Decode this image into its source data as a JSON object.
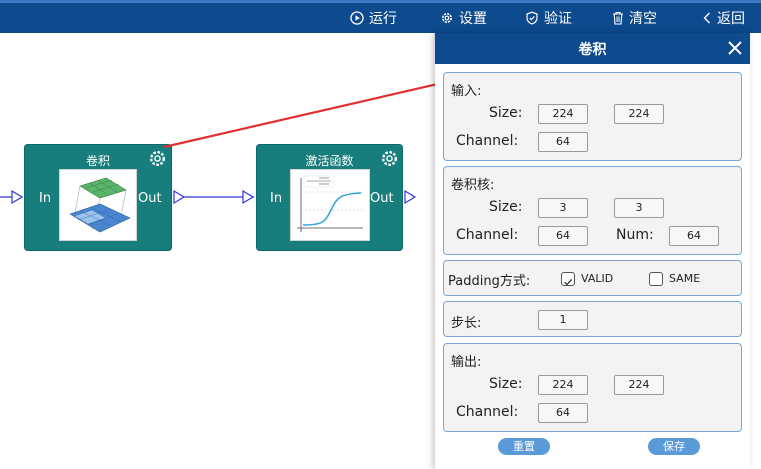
{
  "toolbar": {
    "run": "运行",
    "settings": "设置",
    "validate": "验证",
    "clear": "清空",
    "back": "返回"
  },
  "nodes": {
    "conv": {
      "title": "卷积",
      "in": "In",
      "out": "Out"
    },
    "activation": {
      "title": "激活函数",
      "in": "In",
      "out": "Out"
    }
  },
  "panel": {
    "title": "卷积",
    "input": {
      "heading": "输入:",
      "size_label": "Size:",
      "size_w": "224",
      "size_h": "224",
      "channel_label": "Channel:",
      "channel": "64"
    },
    "kernel": {
      "heading": "卷积核:",
      "size_label": "Size:",
      "size_w": "3",
      "size_h": "3",
      "channel_label": "Channel:",
      "channel": "64",
      "num_label": "Num:",
      "num": "64"
    },
    "padding": {
      "label": "Padding方式:",
      "valid_label": "VALID",
      "valid_checked": true,
      "same_label": "SAME",
      "same_checked": false
    },
    "stride": {
      "label": "步长:",
      "value": "1"
    },
    "output": {
      "heading": "输出:",
      "size_label": "Size:",
      "size_w": "224",
      "size_h": "224",
      "channel_label": "Channel:",
      "channel": "64"
    },
    "buttons": {
      "reset": "重置",
      "save": "保存"
    }
  },
  "colors": {
    "toolbar_bg": "#0d4a8e",
    "node_bg": "#177d7d",
    "wire": "#2f35d8",
    "arrow": "#e03030",
    "button": "#5b9ad9"
  }
}
